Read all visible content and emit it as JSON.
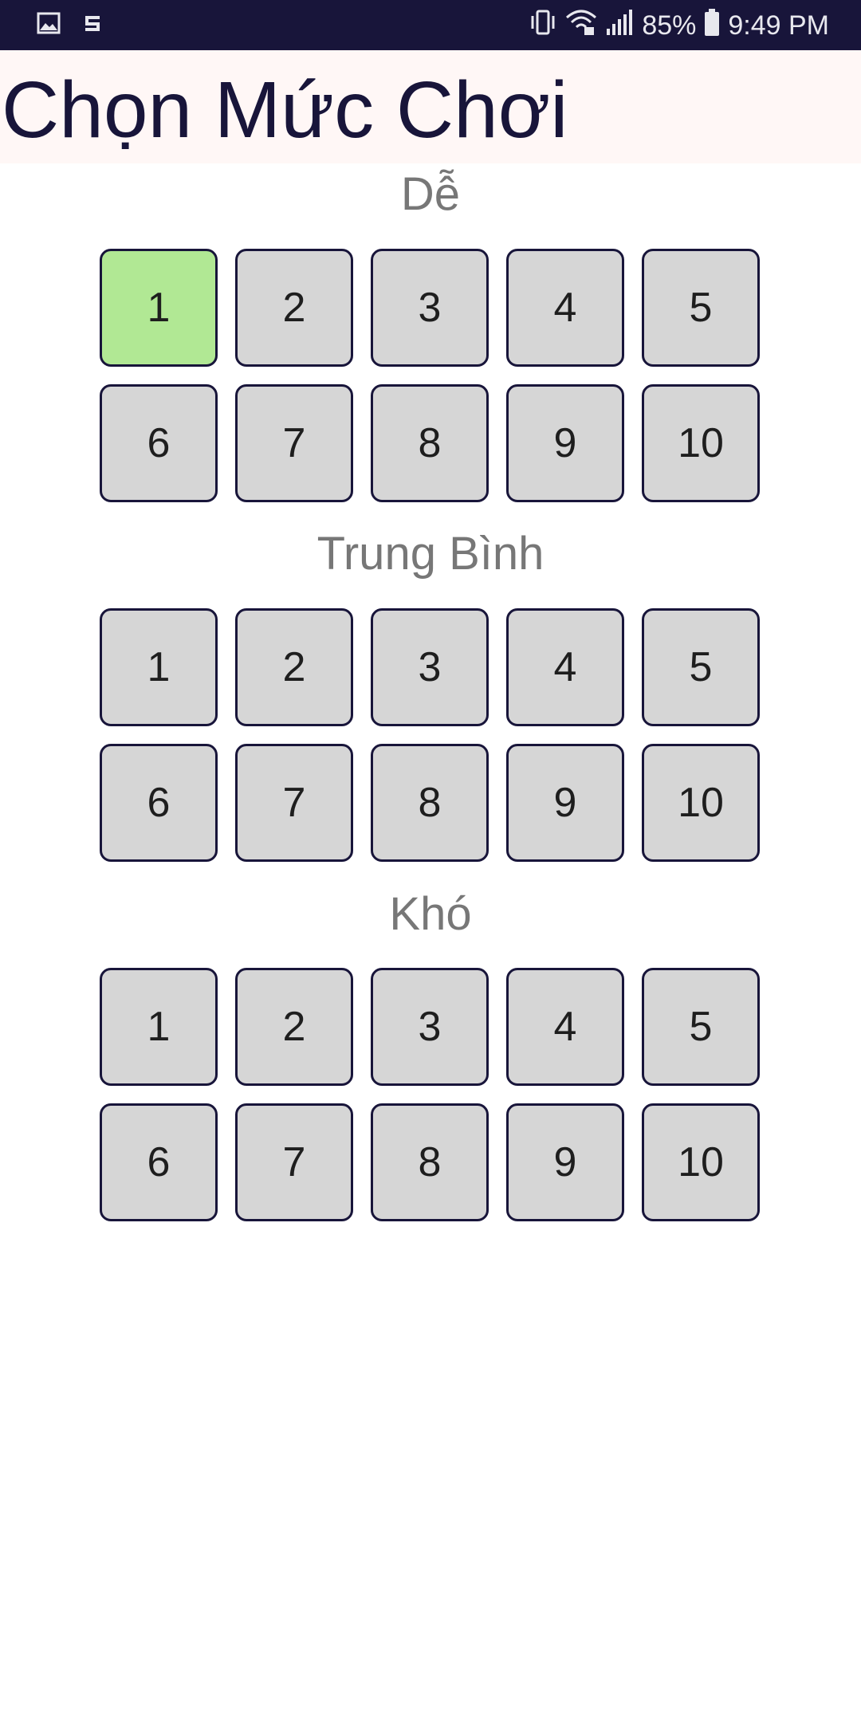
{
  "colors": {
    "status_bar_bg": "#18153a",
    "app_bar_bg": "#fff7f6",
    "title_text": "#18153a",
    "section_title": "#777777",
    "button_bg": "#d6d6d6",
    "button_border": "#18153a",
    "selected_button_bg": "#b1e894"
  },
  "status_bar": {
    "left_icons": [
      "image-icon",
      "stack-icon"
    ],
    "right_icons": [
      "vibrate-icon",
      "wifi-icon",
      "signal-icon"
    ],
    "battery_percent": "85%",
    "time": "9:49 PM"
  },
  "app": {
    "title": "Chọn Mức Chơi"
  },
  "sections": [
    {
      "title": "Dễ",
      "levels": [
        "1",
        "2",
        "3",
        "4",
        "5",
        "6",
        "7",
        "8",
        "9",
        "10"
      ],
      "selected_index": 0
    },
    {
      "title": "Trung Bình",
      "levels": [
        "1",
        "2",
        "3",
        "4",
        "5",
        "6",
        "7",
        "8",
        "9",
        "10"
      ],
      "selected_index": null
    },
    {
      "title": "Khó",
      "levels": [
        "1",
        "2",
        "3",
        "4",
        "5",
        "6",
        "7",
        "8",
        "9",
        "10"
      ],
      "selected_index": null
    }
  ]
}
